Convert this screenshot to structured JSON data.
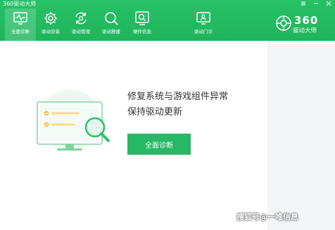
{
  "window": {
    "title": "360驱动大师"
  },
  "nav": [
    {
      "label": "全面诊断",
      "icon": "monitor-pulse-icon",
      "active": true
    },
    {
      "label": "驱动安装",
      "icon": "gear-icon",
      "active": false
    },
    {
      "label": "驱动管理",
      "icon": "refresh-gear-icon",
      "active": false
    },
    {
      "label": "驱动救援",
      "icon": "search-icon",
      "active": false
    },
    {
      "label": "硬件信息",
      "icon": "hardware-search-icon",
      "active": false
    },
    {
      "label": "驱动门诊",
      "icon": "monitor-user-icon",
      "active": false
    }
  ],
  "brand": {
    "number": "360",
    "name": "驱动大师"
  },
  "main": {
    "headline_line1": "修复系统与游戏组件异常",
    "headline_line2": "保持驱动更新",
    "button_label": "全面诊断"
  },
  "watermark": "搜狐号@一唯信息",
  "colors": {
    "header_green": "#22b962",
    "button_green": "#26b865",
    "text_dark": "#333333",
    "panel_gray": "#f4f5f7"
  }
}
